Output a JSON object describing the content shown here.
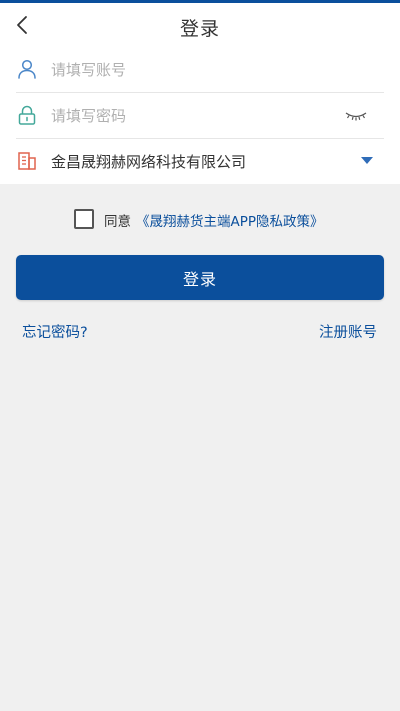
{
  "header": {
    "title": "登录",
    "back_icon": "chevron-left-icon"
  },
  "form": {
    "account": {
      "placeholder": "请填写账号",
      "value": "",
      "icon": "user-icon"
    },
    "password": {
      "placeholder": "请填写密码",
      "value": "",
      "icon": "lock-icon",
      "toggle_icon": "eye-closed-icon"
    },
    "company": {
      "selected": "金昌晟翔赫网络科技有限公司",
      "icon": "building-icon",
      "dropdown_icon": "caret-down-icon"
    }
  },
  "agreement": {
    "checked": false,
    "label": "同意",
    "policy_link": "《晟翔赫货主端APP隐私政策》"
  },
  "login_button": "登录",
  "links": {
    "forgot": "忘记密码?",
    "register": "注册账号"
  },
  "colors": {
    "primary": "#0b4f9c",
    "background": "#f0f0f0",
    "placeholder": "#b0b0b0"
  }
}
